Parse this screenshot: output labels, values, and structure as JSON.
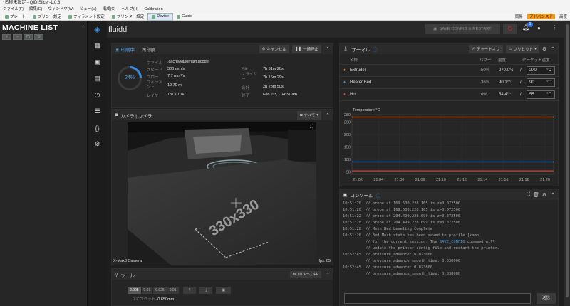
{
  "window": {
    "title": "*名称未設定 - QIDISlicer-1.0.8"
  },
  "menu": [
    "ファイル(F)",
    "編集(E)",
    "ウィンドウ(W)",
    "ビュー(V)",
    "構成(C)",
    "ヘルプ(H)",
    "Calibration"
  ],
  "tabs": [
    {
      "label": "プレート"
    },
    {
      "label": "プリント設定"
    },
    {
      "label": "フィラメント設定"
    },
    {
      "label": "プリンター設定"
    },
    {
      "label": "Device"
    },
    {
      "label": "Guide"
    }
  ],
  "tab_right": {
    "a": "簡易",
    "b": "アドバンスド",
    "c": "高度"
  },
  "machine_list": {
    "title": "MACHINE LIST",
    "collapse": "‹"
  },
  "app": {
    "brand": "fluidd",
    "save_config": "SAVE CONFIG & RESTART",
    "notif_count": "1"
  },
  "job": {
    "tab_printing": "印刷中",
    "tab_reprint": "再印刷",
    "cancel": "キャンセル",
    "pause": "一時停止",
    "progress": "24%",
    "progress_value": 0.24,
    "file_label": "ファイル",
    "file_value": ".cache/yasomain.gcode",
    "speed_label": "スピード",
    "speed_value": "300 mm/s",
    "flow_label": "フロー",
    "flow_value": "7.7 mm³/s",
    "filament_label": "フィラメ\nント",
    "filament_value": "19.70 m",
    "layer_label": "レイヤー",
    "layer_value": "131 / 1047",
    "file_time_label": "File",
    "file_time_value": "7h 51m 20s",
    "slicer_label": "スライサ\nー",
    "slicer_value": "7h 16m 29s",
    "total_label": "合計",
    "total_value": "2h 28m 50s",
    "eta_label": "終了",
    "eta_value": "Feb. 03, - 04:37 am"
  },
  "camera": {
    "title": "カメラ | カメラ",
    "all_label": "すべて",
    "name": "X-Max3 Camera",
    "fps": "fps: 05",
    "bed_text": "330x330"
  },
  "tools": {
    "title": "ツール",
    "motors_off": "MOTORS OFF",
    "steps": [
      "0.005",
      "0.01",
      "0.025",
      "0.05"
    ],
    "z_offset_label": "Zオフセット",
    "z_offset_value": "-0.650mm"
  },
  "thermal": {
    "title": "サーマル",
    "chart_off": "チャートオフ",
    "preset": "プリセット",
    "col_name": "名称",
    "col_power": "パワー",
    "col_temp": "温度",
    "col_target": "ターゲット温度",
    "heaters": [
      {
        "name": "Extruder",
        "power": "50%",
        "temp": "270.0°c",
        "slash": "/",
        "target": "270",
        "unit": "°C",
        "color": "#e8742a"
      },
      {
        "name": "Heater Bed",
        "power": "36%",
        "temp": "90.1°c",
        "slash": "/",
        "target": "90",
        "unit": "°C",
        "color": "#3a8fe0"
      },
      {
        "name": "Hot",
        "power": "0%",
        "temp": "54.4°c",
        "slash": "/",
        "target": "55",
        "unit": "°C",
        "color": "#e03a3a"
      }
    ]
  },
  "chart_data": {
    "type": "line",
    "title": "Temperature °C",
    "xlabel": "",
    "ylabel": "Temperature °C",
    "x": [
      "21:02",
      "21:04",
      "21:06",
      "21:08",
      "21:10",
      "21:12",
      "21:14",
      "21:16",
      "21:18",
      "21:20"
    ],
    "ylim": [
      40,
      280
    ],
    "yticks": [
      50,
      100,
      150,
      200,
      250,
      280
    ],
    "series": [
      {
        "name": "Extruder",
        "color": "#e8742a",
        "values": [
          270,
          270,
          270,
          270,
          270,
          270,
          270,
          270,
          270,
          270
        ]
      },
      {
        "name": "Heater Bed",
        "color": "#3a8fe0",
        "values": [
          90,
          90,
          90,
          90,
          90,
          90,
          90,
          90,
          90,
          90
        ]
      },
      {
        "name": "Hot",
        "color": "#e03a3a",
        "values": [
          54,
          54,
          54,
          54,
          54,
          54,
          54,
          54,
          54,
          54
        ]
      }
    ]
  },
  "console": {
    "title": "コンソール",
    "send": "送信",
    "lines": [
      {
        "ts": "10:51:20",
        "text": "// probe at 169.500,228.105 is z=0.072500"
      },
      {
        "ts": "10:51:20",
        "text": "// probe at 169.500,228.105 is z=0.072500"
      },
      {
        "ts": "10:51:22",
        "text": "// probe at 204.499,228.099 is z=0.072500"
      },
      {
        "ts": "10:51:28",
        "text": "// probe at 204.499,228.099 is z=0.072500"
      },
      {
        "ts": "10:51:28",
        "text": "// Mesh Bed Leveling Complete"
      },
      {
        "ts": "10:51:28",
        "text": "// Bed Mesh state has been saved to profile [kamo]"
      },
      {
        "ts": "",
        "text": "// for the current session. The ",
        "link": "SAVE_CONFIG",
        "after": " command will"
      },
      {
        "ts": "",
        "text": "// update the printer config file and restart the printer."
      },
      {
        "ts": "10:52:45",
        "text": "// pressure_advance: 0.023000"
      },
      {
        "ts": "",
        "text": "// pressure_advance_smooth_time: 0.030000"
      },
      {
        "ts": "10:52:45",
        "text": "// pressure_advance: 0.023000"
      },
      {
        "ts": "",
        "text": "// pressure_advance_smooth_time: 0.030000"
      }
    ]
  }
}
